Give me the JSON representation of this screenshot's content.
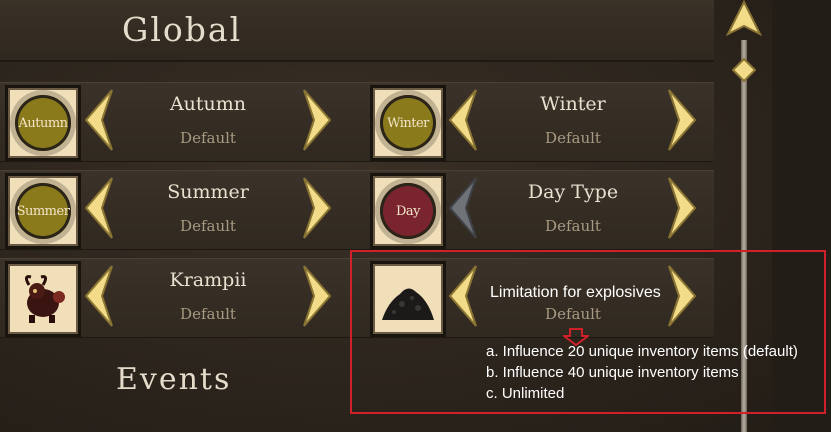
{
  "sections": {
    "global_title": "Global",
    "events_title": "Events"
  },
  "options": [
    {
      "icon": "Autumn",
      "title": "Autumn",
      "value": "Default"
    },
    {
      "icon": "Winter",
      "title": "Winter",
      "value": "Default"
    },
    {
      "icon": "Summer",
      "title": "Summer",
      "value": "Default"
    },
    {
      "icon": "Day",
      "title": "Day Type",
      "value": "Default"
    },
    {
      "icon": "krampus-icon",
      "title": "Krampii",
      "value": "Default"
    },
    {
      "icon": "gunpowder-pile-icon",
      "title": "",
      "value": "Default"
    }
  ],
  "annotation": {
    "title": "Limitation for explosives",
    "lines": [
      "a. Influence 20 unique inventory items (default)",
      "b. Influence 40 unique inventory items",
      "c. Unlimited"
    ],
    "box_color": "#d0202a"
  },
  "colors": {
    "arrow_gold": "#f2dc8a",
    "arrow_disabled": "#6f7378",
    "seal_olive": "#8a7a1c",
    "seal_red": "#7a2430"
  }
}
